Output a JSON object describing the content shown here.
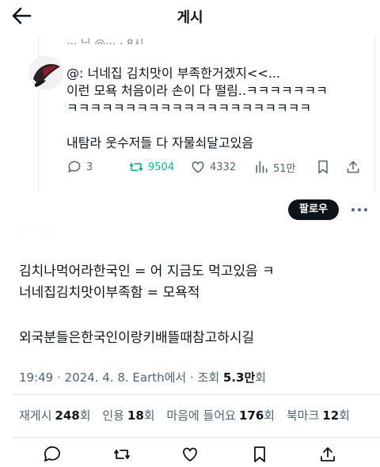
{
  "header": {
    "title": "게시"
  },
  "quote": {
    "handle_partial": "··· 님 @··· · 8시",
    "text_lines": [
      "@: 너네집 김치맛이 부족한거겠지<<...",
      "이런 모욕 처음이라 손이 다 떨림..ㅋㅋㅋㅋㅋㅋㅋ",
      "ㅋㅋㅋㅋㅋㅋㅋㅋㅋㅋㅋㅋㅋㅋㅋㅋㅋㅋㅋㅋㅋ",
      "내탐라 웃수저들 다 자물쇠달고있음"
    ],
    "actions": {
      "replies": "3",
      "retweets": "9504",
      "likes": "4332",
      "views": "51만"
    }
  },
  "follow_button": "팔로우",
  "main": {
    "text_lines": [
      "김치나먹어라한국인 = 어 지금도 먹고있음 ㅋ",
      "너네집김치맛이부족함 = 모욕적",
      "외국분들은한국인이랑키배뜰때참고하시길"
    ],
    "meta": {
      "prefix": "19:49 · 2024. 4. 8. Earth에서 · 조회 ",
      "views": "5.3만",
      "suffix": "회"
    },
    "stats": [
      {
        "label": "재게시",
        "value": "248",
        "unit": "회"
      },
      {
        "label": "인용",
        "value": "18",
        "unit": "회"
      },
      {
        "label": "마음에 들어요",
        "value": "176",
        "unit": "회"
      },
      {
        "label": "북마크",
        "value": "12",
        "unit": "회"
      }
    ]
  },
  "colors": {
    "retweet_green": "#00ba7c",
    "text": "#0f1419",
    "muted": "#536471"
  }
}
